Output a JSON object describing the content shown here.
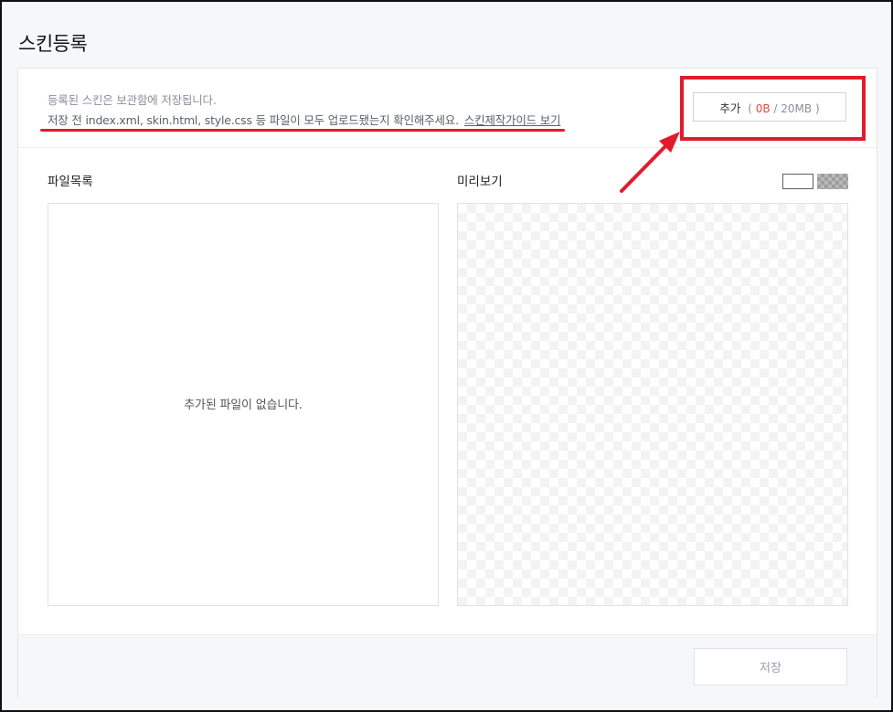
{
  "page": {
    "title": "스킨등록"
  },
  "info": {
    "line1": "등록된 스킨은 보관함에 저장됩니다.",
    "line2": "저장 전 index.xml, skin.html, style.css 등 파일이 모두 업로드됐는지 확인해주세요.",
    "guide_link": "스킨제작가이드 보기"
  },
  "add_button": {
    "label": "추가",
    "open_paren": "(",
    "used": "0B",
    "separator": "/",
    "limit": "20MB",
    "close_paren": ")"
  },
  "file_list": {
    "label": "파일목록",
    "empty_message": "추가된 파일이 없습니다."
  },
  "preview": {
    "label": "미리보기",
    "bg_options": [
      "white-background-icon",
      "checkerboard-background-icon"
    ]
  },
  "footer": {
    "save_label": "저장"
  },
  "colors": {
    "annotation_red": "#e21b2c",
    "used_size_red": "#e4483a"
  }
}
